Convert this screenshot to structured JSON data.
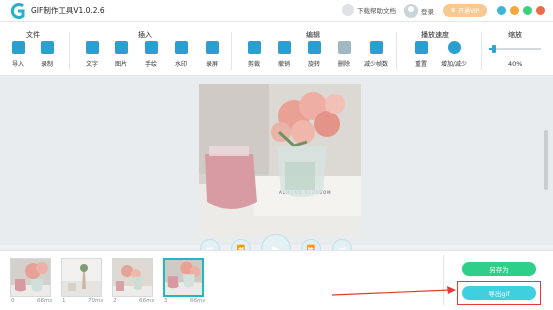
{
  "titlebar": {
    "app_title": "GIF制作工具V1.0.2.6",
    "help_doc": "下载帮助文档",
    "login": "登录",
    "vip": "开通VIP"
  },
  "toolbar": {
    "groups": {
      "file": "文件",
      "insert": "插入",
      "edit": "编辑",
      "speed": "播放速度",
      "zoom": "缩放"
    },
    "tools": {
      "import": "导入",
      "record": "录制",
      "text": "文字",
      "image": "图片",
      "handwrite": "手绘",
      "watermark": "水印",
      "screen_record": "录屏",
      "crop": "剪裁",
      "undo": "撤销",
      "rotate": "旋转",
      "delete": "删除",
      "reduce_frames": "减少帧数",
      "reset": "重置",
      "speed_adjust": "增加/减少"
    },
    "zoom_value": "40%",
    "zoom_level": 0.05
  },
  "preview": {
    "sign_text": "ALMOND BLOSSOM"
  },
  "frames": [
    {
      "index": "0",
      "duration": "66ms"
    },
    {
      "index": "1",
      "duration": "70ms"
    },
    {
      "index": "2",
      "duration": "66ms"
    },
    {
      "index": "3",
      "duration": "66ms"
    }
  ],
  "actions": {
    "save_as": "另存为",
    "export_gif": "导出gif"
  },
  "colors": {
    "accent": "#2a9fd0",
    "export_button": "#3fd0df",
    "save_button": "#2ecf88",
    "highlight": "#e53a3a"
  }
}
